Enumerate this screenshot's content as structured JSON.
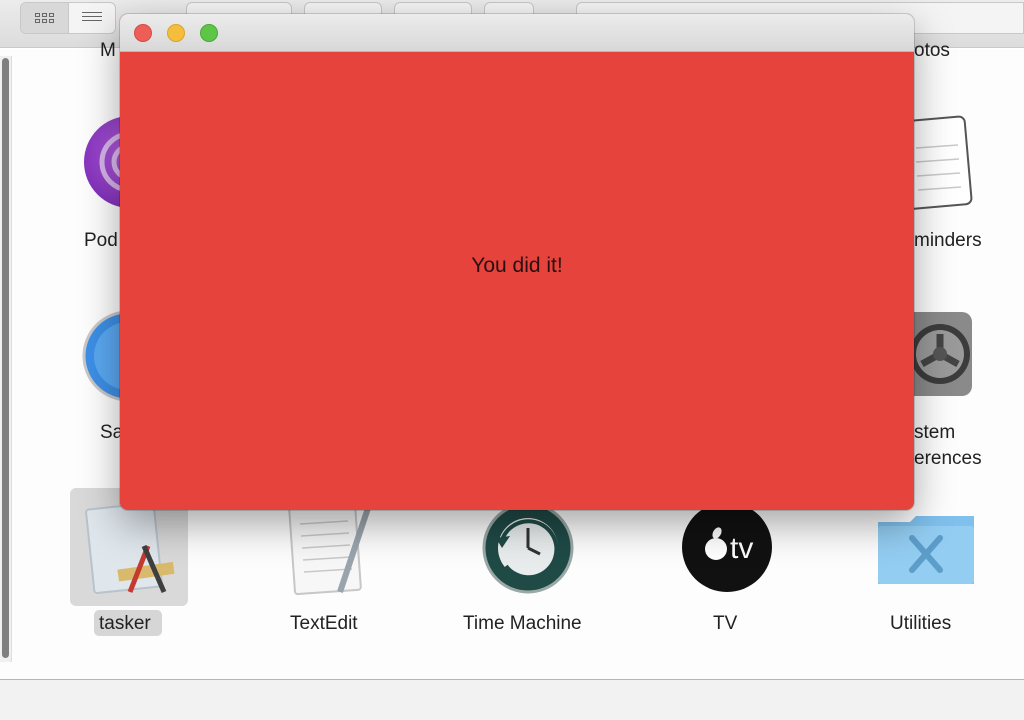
{
  "finder": {
    "apps": [
      {
        "label": "Podcasts",
        "visible": "Pod"
      },
      {
        "label": "Reminders",
        "visible": "minders"
      },
      {
        "label": "Safari",
        "visible": "Sa"
      },
      {
        "label": "System Preferences",
        "visible_line1": "stem",
        "visible_line2": "erences"
      },
      {
        "label": "tasker"
      },
      {
        "label": "TextEdit"
      },
      {
        "label": "Time Machine"
      },
      {
        "label": "TV"
      },
      {
        "label": "Utilities"
      }
    ],
    "top_partial_left": "M",
    "top_partial_right": "otos"
  },
  "window": {
    "message": "You did it!",
    "background_color": "#e5433c"
  },
  "icons": {
    "view_icons": "icon-view-icon",
    "view_list": "list-view-icon",
    "tv_logo_text": "tv"
  }
}
